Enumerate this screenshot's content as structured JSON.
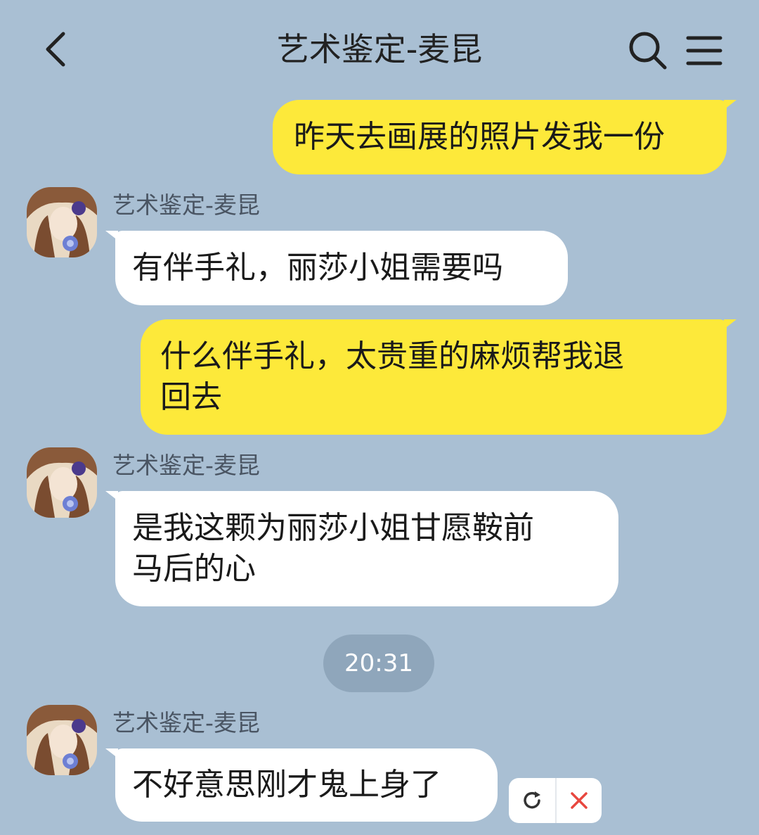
{
  "header": {
    "title": "艺术鉴定-麦昆",
    "back_icon": "chevron-left-icon",
    "search_icon": "search-icon",
    "menu_icon": "hamburger-menu-icon"
  },
  "messages": [
    {
      "side": "me",
      "text": "昨天去画展的照片发我一份"
    },
    {
      "side": "them",
      "sender": "艺术鉴定-麦昆",
      "text": "有伴手礼，丽莎小姐需要吗"
    },
    {
      "side": "me",
      "text_line1": "什么伴手礼，太贵重的麻烦帮我退",
      "text_line2": "回去"
    },
    {
      "side": "them",
      "sender": "艺术鉴定-麦昆",
      "text_line1": "是我这颗为丽莎小姐甘愿鞍前",
      "text_line2": "马后的心"
    },
    {
      "side": "them",
      "sender": "艺术鉴定-麦昆",
      "text": "不好意思刚才鬼上身了"
    }
  ],
  "timestamp": "20:31",
  "failed_actions": {
    "retry_icon": "refresh-icon",
    "cancel_icon": "close-icon"
  },
  "colors": {
    "background": "#a9bfd3",
    "my_bubble": "#fde93a",
    "their_bubble": "#ffffff",
    "timestamp_pill": "#8fa6bb",
    "cancel_red": "#e8473f"
  }
}
